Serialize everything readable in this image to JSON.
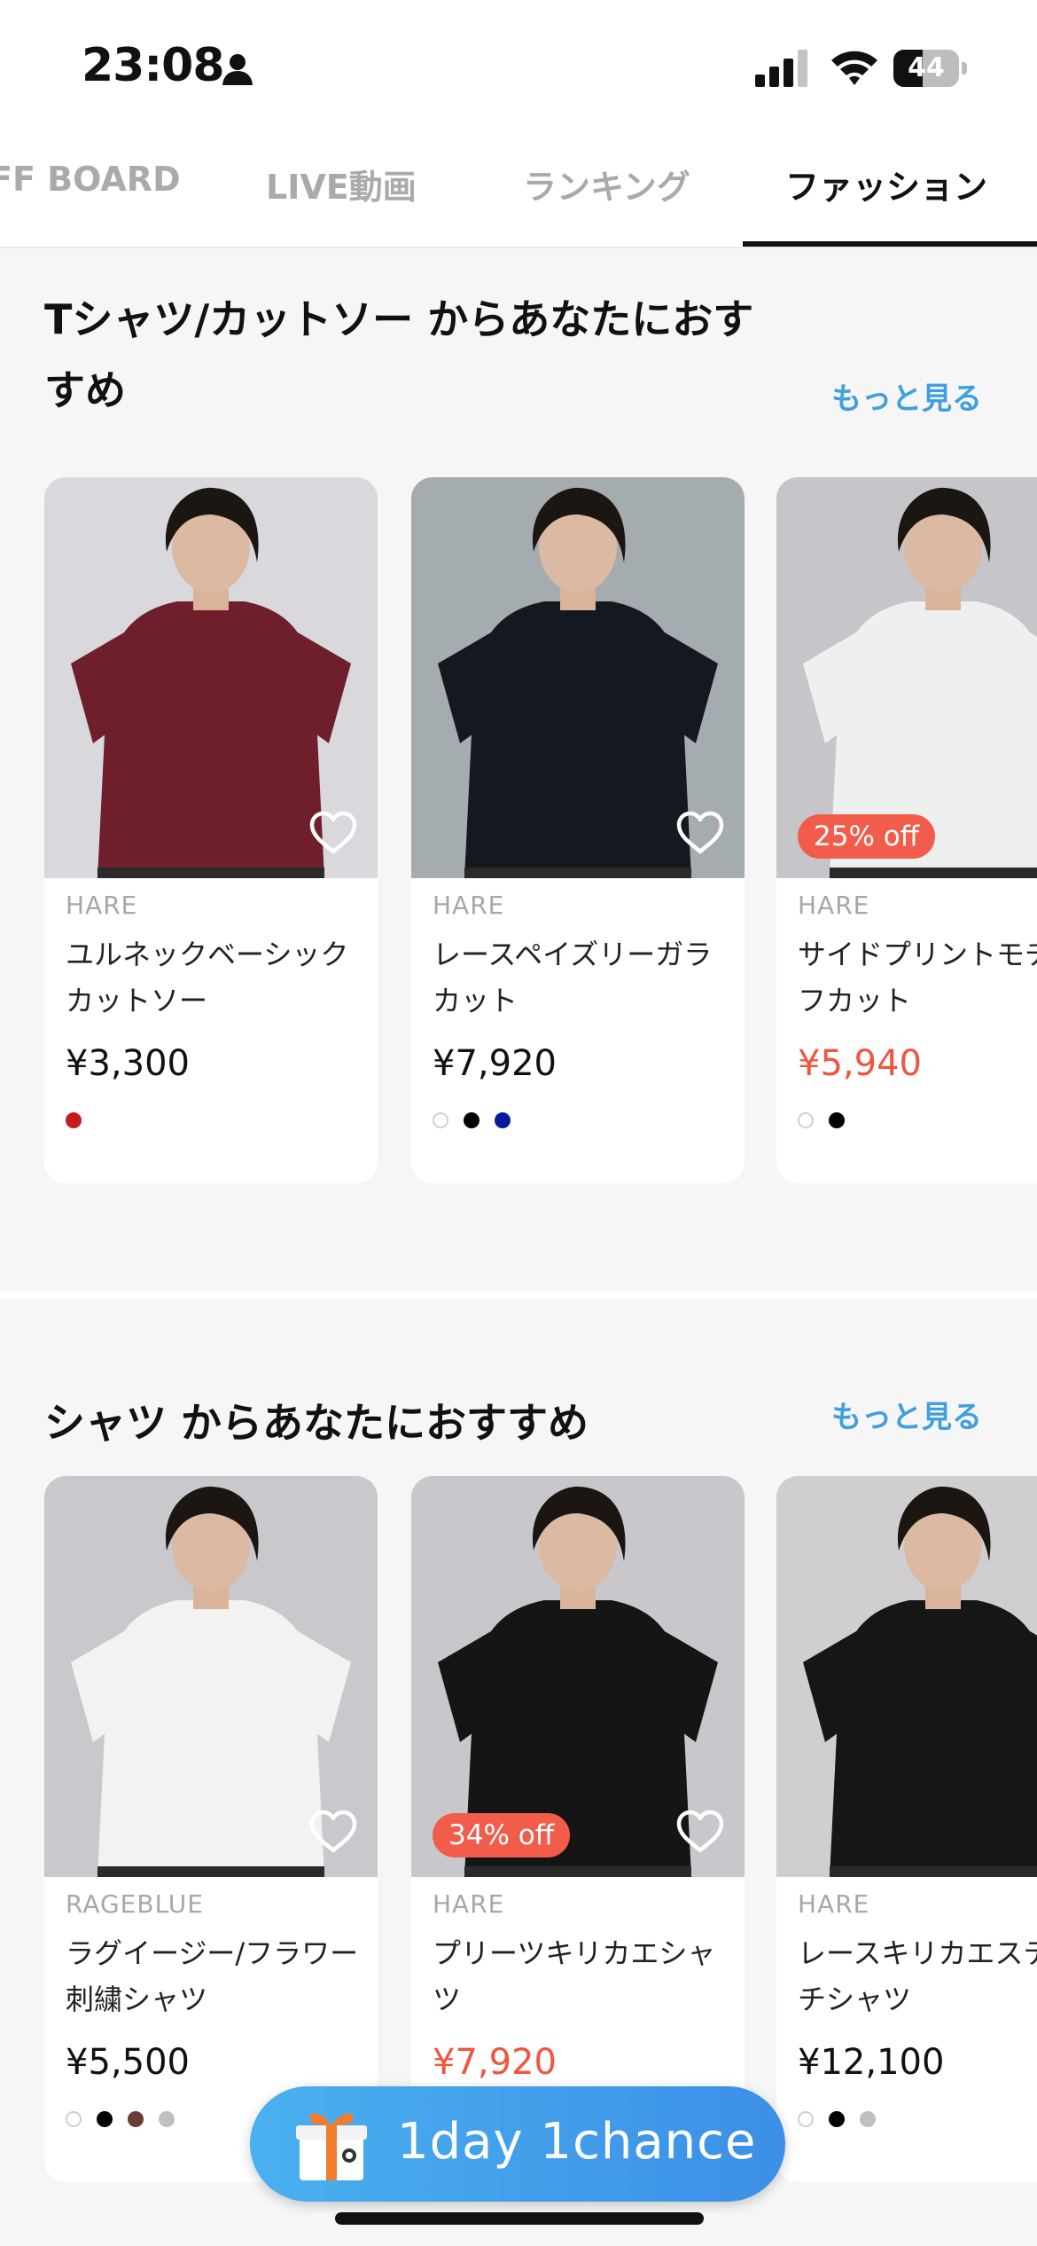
{
  "status_bar": {
    "time": "23:08",
    "battery": "44",
    "battery_level": 0.44
  },
  "tabs": [
    {
      "label": "FF BOARD",
      "active": false
    },
    {
      "label": "LIVE動画",
      "active": false
    },
    {
      "label": "ランキング",
      "active": false
    },
    {
      "label": "ファッション",
      "active": true
    }
  ],
  "sections": [
    {
      "title": "Tシャツ/カットソー からあなたにおすすめ",
      "more": "もっと見る",
      "products": [
        {
          "brand": "HARE",
          "name": "ユルネックベーシックカットソー",
          "price": "¥3,300",
          "sale": false,
          "discount": "",
          "colors": [
            "#c51a1a"
          ],
          "shirt_color": "#6e1f2b",
          "bg": "#d9d8dc"
        },
        {
          "brand": "HARE",
          "name": "レースペイズリーガラカット",
          "price": "¥7,920",
          "sale": false,
          "discount": "",
          "colors": [
            "#ffffff",
            "#000000",
            "#0a1a9c"
          ],
          "shirt_color": "#141820",
          "bg": "#a5acb0"
        },
        {
          "brand": "HARE",
          "name": "サイドプリントモチーフカット",
          "price": "¥5,940",
          "sale": true,
          "discount": "25% off",
          "colors": [
            "#ffffff",
            "#000000"
          ],
          "shirt_color": "#eef0f0",
          "bg": "#c6c6ca"
        }
      ]
    },
    {
      "title": "シャツ からあなたにおすすめ",
      "more": "もっと見る",
      "products": [
        {
          "brand": "RAGEBLUE",
          "name": "ラグイージー/フラワー刺繍シャツ",
          "price": "¥5,500",
          "sale": false,
          "discount": "",
          "colors": [
            "#ffffff",
            "#000000",
            "#6b3c36",
            "#c0c0c0"
          ],
          "shirt_color": "#f2f2f0",
          "bg": "#c9c8cc"
        },
        {
          "brand": "HARE",
          "name": "プリーツキリカエシャツ",
          "price": "¥7,920",
          "sale": true,
          "discount": "34% off",
          "colors": [],
          "shirt_color": "#151515",
          "bg": "#c8c8cc"
        },
        {
          "brand": "HARE",
          "name": "レースキリカエステッチシャツ",
          "price": "¥12,100",
          "sale": false,
          "discount": "",
          "colors": [
            "#ffffff",
            "#000000",
            "#c0c0c0"
          ],
          "shirt_color": "#161616",
          "bg": "#cfcfd2"
        }
      ]
    }
  ],
  "banner": {
    "text": "1day 1chance"
  },
  "icons": {
    "person": "person-icon",
    "signal": "signal-icon",
    "wifi": "wifi-icon",
    "heart": "heart-icon",
    "gift": "gift-icon"
  }
}
